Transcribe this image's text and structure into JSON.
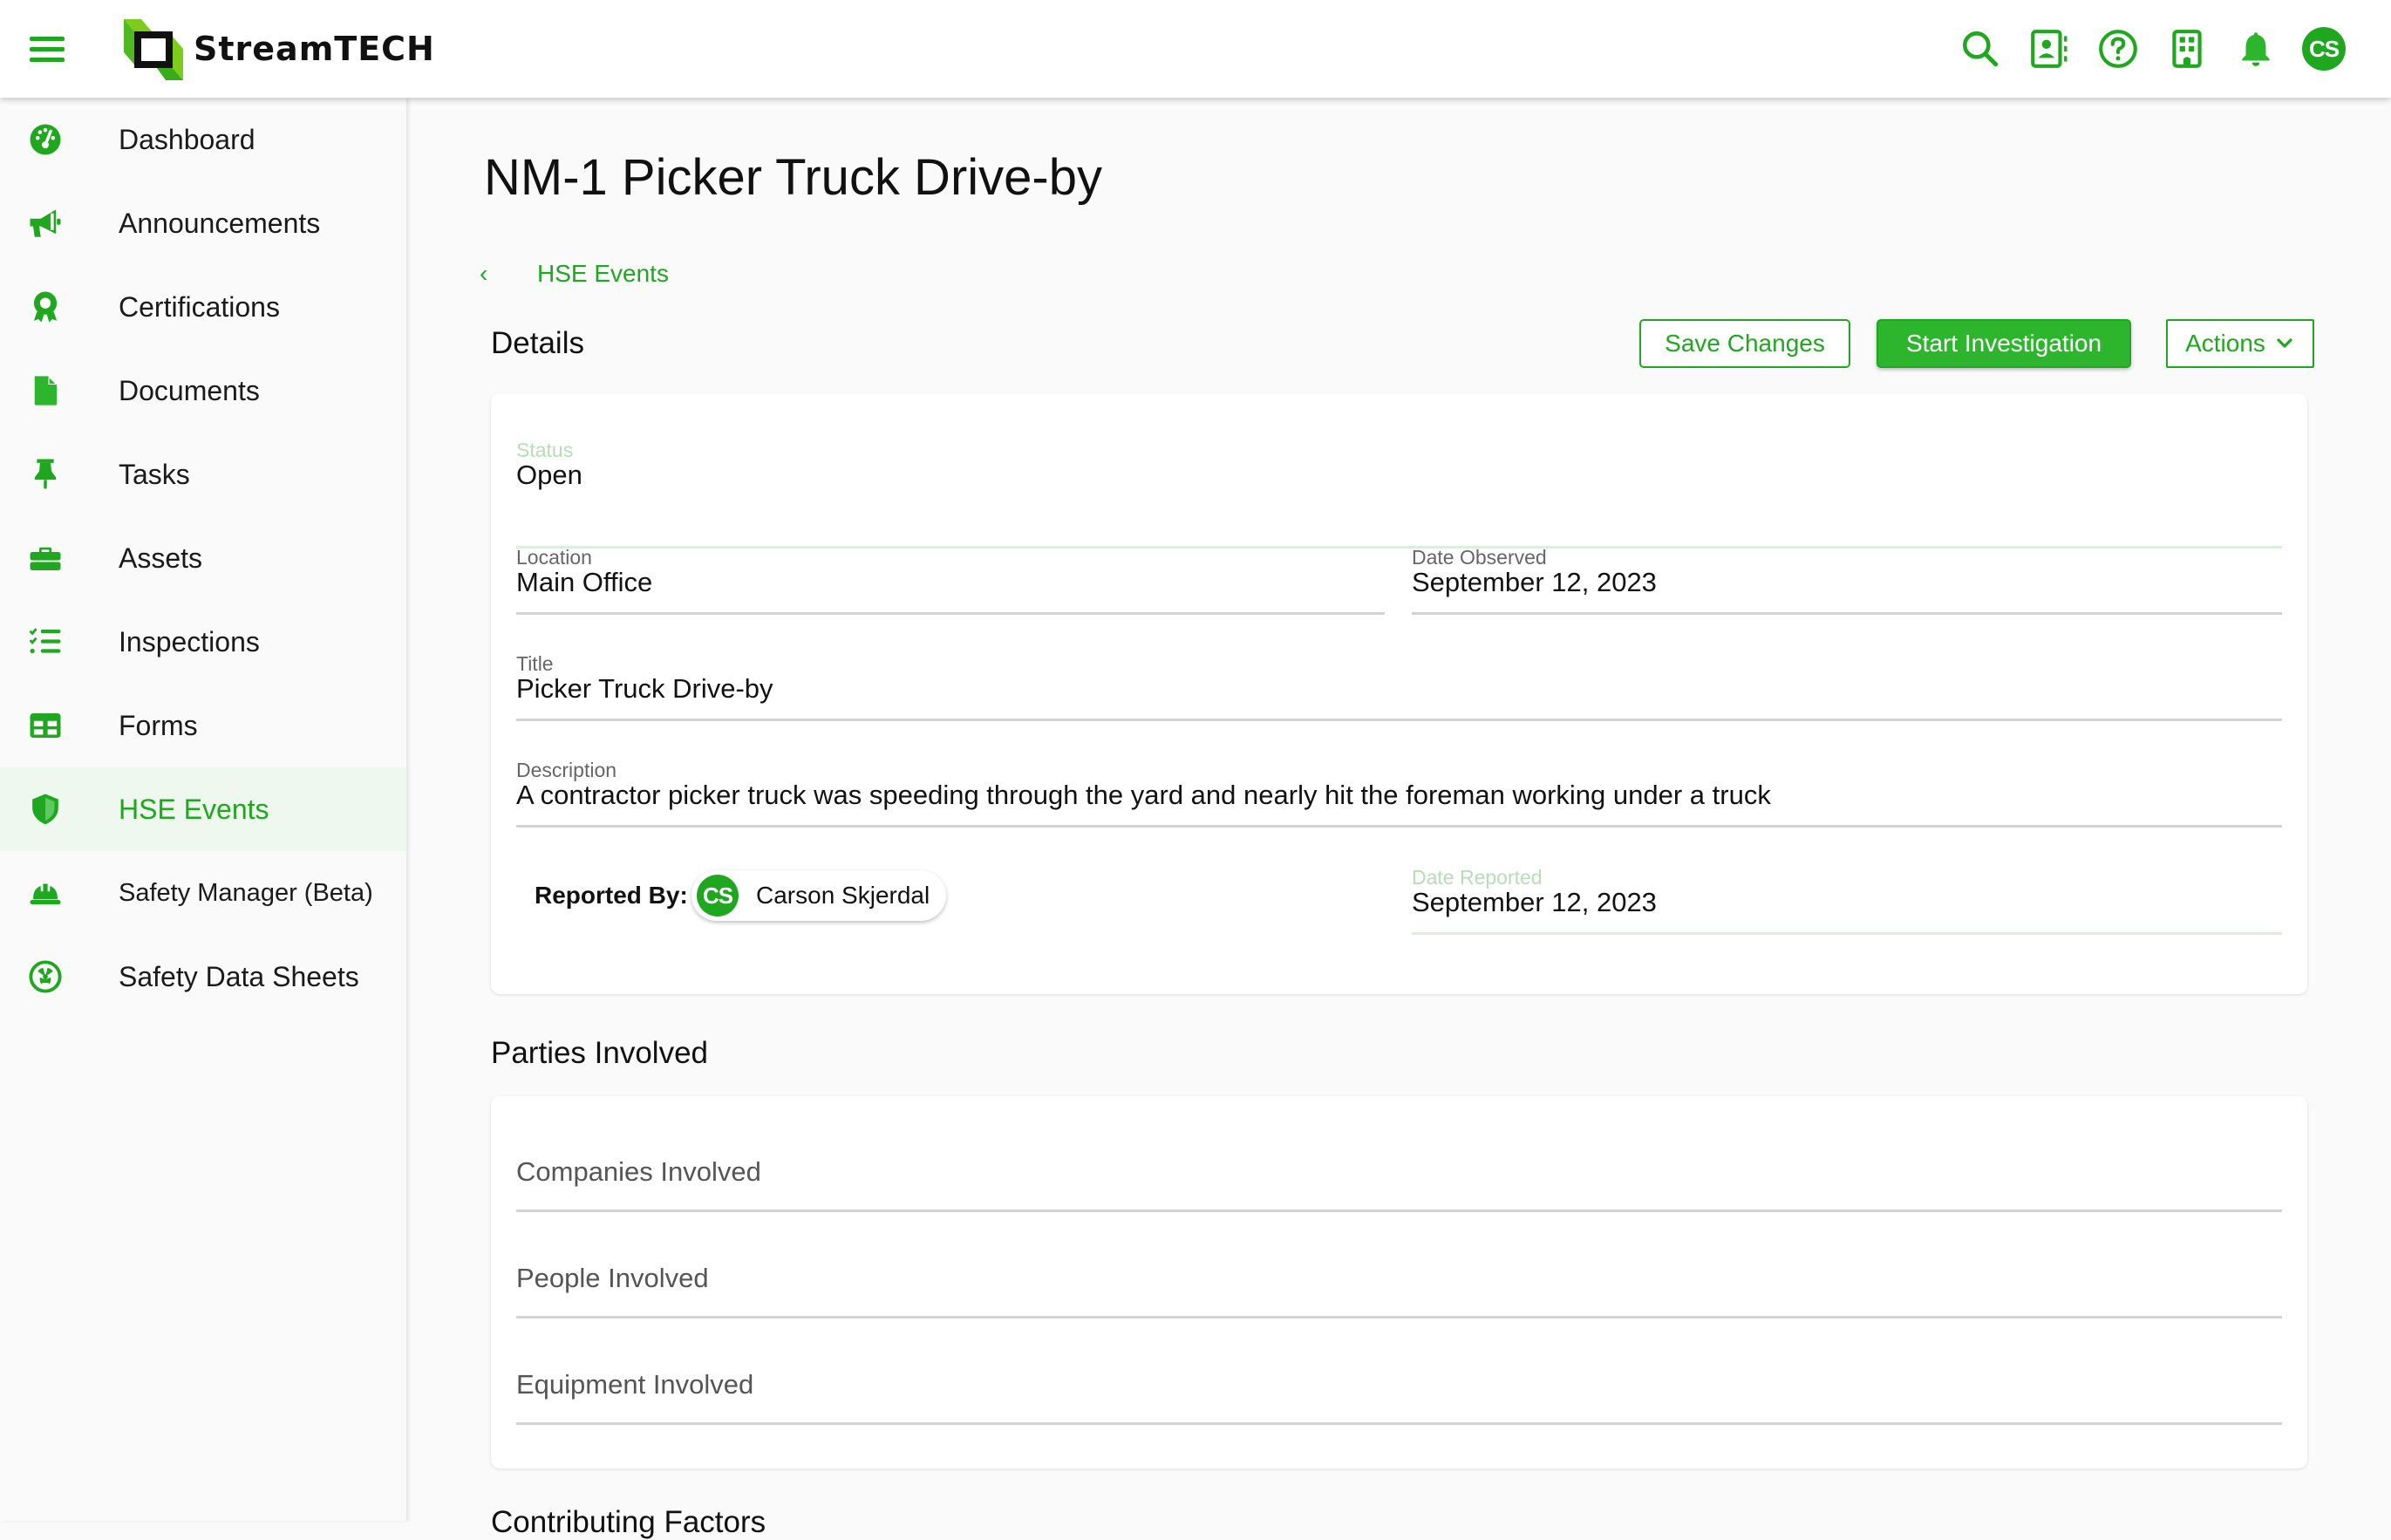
{
  "header": {
    "brand": "StreamTECH",
    "icons": [
      "search-icon",
      "contacts-icon",
      "help-icon",
      "building-icon",
      "bell-icon"
    ],
    "user_initials": "CS"
  },
  "sidebar": {
    "items": [
      {
        "label": "Dashboard",
        "icon": "dashboard-icon",
        "active": false
      },
      {
        "label": "Announcements",
        "icon": "megaphone-icon",
        "active": false
      },
      {
        "label": "Certifications",
        "icon": "award-icon",
        "active": false
      },
      {
        "label": "Documents",
        "icon": "document-icon",
        "active": false
      },
      {
        "label": "Tasks",
        "icon": "pushpin-icon",
        "active": false
      },
      {
        "label": "Assets",
        "icon": "toolbox-icon",
        "active": false
      },
      {
        "label": "Inspections",
        "icon": "checklist-icon",
        "active": false
      },
      {
        "label": "Forms",
        "icon": "table-icon",
        "active": false
      },
      {
        "label": "HSE Events",
        "icon": "shield-icon",
        "active": true
      },
      {
        "label": "Safety Manager (Beta)",
        "icon": "hardhat-icon",
        "active": false
      },
      {
        "label": "Safety Data Sheets",
        "icon": "radiation-icon",
        "active": false
      }
    ]
  },
  "page": {
    "title": "NM-1 Picker Truck Drive-by",
    "breadcrumb": {
      "chevron": "‹",
      "label": "HSE Events"
    }
  },
  "details": {
    "heading": "Details",
    "buttons": {
      "save": "Save Changes",
      "start_investigation": "Start Investigation",
      "actions": "Actions"
    },
    "fields": {
      "status": {
        "label": "Status",
        "value": "Open"
      },
      "location": {
        "label": "Location",
        "value": "Main Office"
      },
      "date_observed": {
        "label": "Date Observed",
        "value": "September 12, 2023"
      },
      "title": {
        "label": "Title",
        "value": "Picker Truck Drive-by"
      },
      "description": {
        "label": "Description",
        "value": "A contractor picker truck was speeding through the yard and nearly hit the foreman working under a truck"
      },
      "reported_by": {
        "label": "Reported By:",
        "initials": "CS",
        "name": "Carson Skjerdal"
      },
      "date_reported": {
        "label": "Date Reported",
        "value": "September 12, 2023"
      }
    }
  },
  "parties": {
    "heading": "Parties Involved",
    "fields": [
      {
        "placeholder": "Companies Involved"
      },
      {
        "placeholder": "People Involved"
      },
      {
        "placeholder": "Equipment Involved"
      }
    ]
  },
  "next_section": {
    "heading": "Contributing Factors"
  },
  "colors": {
    "accent": "#1fa81f",
    "accent_light": "#eef8ee",
    "background": "#fafafa"
  }
}
